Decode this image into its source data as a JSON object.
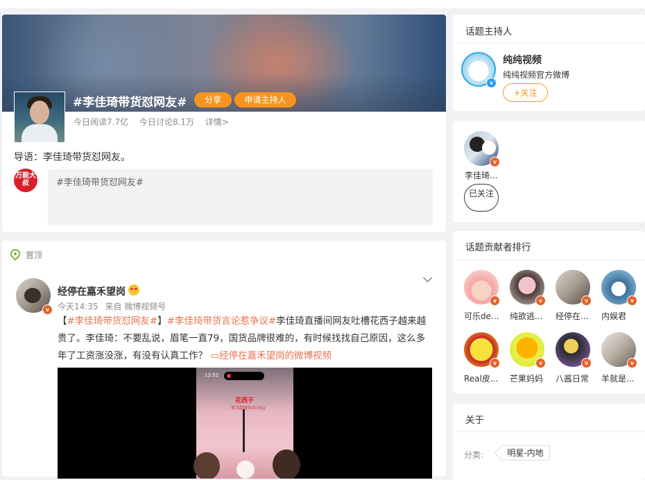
{
  "topic": {
    "title": "#李佳琦带货怼网友#",
    "share_label": "分享",
    "apply_host_label": "申请主持人",
    "reads_today": "今日阅读7.7亿",
    "discussions_today": "今日讨论8.1万",
    "details_link": "详情>",
    "guide": "导语：李佳琦带货怼网友。",
    "composer_text": "#李佳琦带货怼网友#",
    "composer_avatar_text": "万能大叔"
  },
  "feed": {
    "pinned_label": "置顶",
    "post": {
      "author": "经停在嘉禾望岗",
      "time": "今天14:35",
      "source": "来自 微博视频号",
      "text_bracket_open": "【",
      "hashtag_1": "#李佳琦带货怼网友#",
      "text_bracket_close": "】",
      "hashtag_2": "#李佳琦带货言论惹争议#",
      "text_body": "李佳琦直播间网友吐槽花西子越来越贵了。李佳琦：不要乱说，眉笔一直79，国货品牌很难的，有时候找找自己原因，这么多年了工资涨没涨，有没有认真工作？",
      "video_link": "经停在嘉禾望岗的微博视频",
      "video_time": "12:52",
      "video_sign": "花西子",
      "video_sub": "官方超级Tel0.05g"
    }
  },
  "sidebar": {
    "host": {
      "title": "话题主持人",
      "name": "纯纯视频",
      "desc": "纯纯视频官方微博",
      "follow_label": "+关注"
    },
    "followed": {
      "name": "李佳琦...",
      "button_label": "已关注"
    },
    "rank": {
      "title": "话题贡献者排行",
      "items": [
        {
          "name": "可乐de..."
        },
        {
          "name": "纯欲逃..."
        },
        {
          "name": "经停在..."
        },
        {
          "name": "内娱君"
        },
        {
          "name": "Real皮..."
        },
        {
          "name": "芒果妈妈"
        },
        {
          "name": "八酱日常"
        },
        {
          "name": "羊就是..."
        }
      ]
    },
    "about": {
      "title": "关于",
      "category_label": "分类:",
      "category_value": "明星-内地"
    }
  },
  "colors": {
    "accent": "#f7941e",
    "link": "#eb7350",
    "verified": "#e6612a"
  }
}
